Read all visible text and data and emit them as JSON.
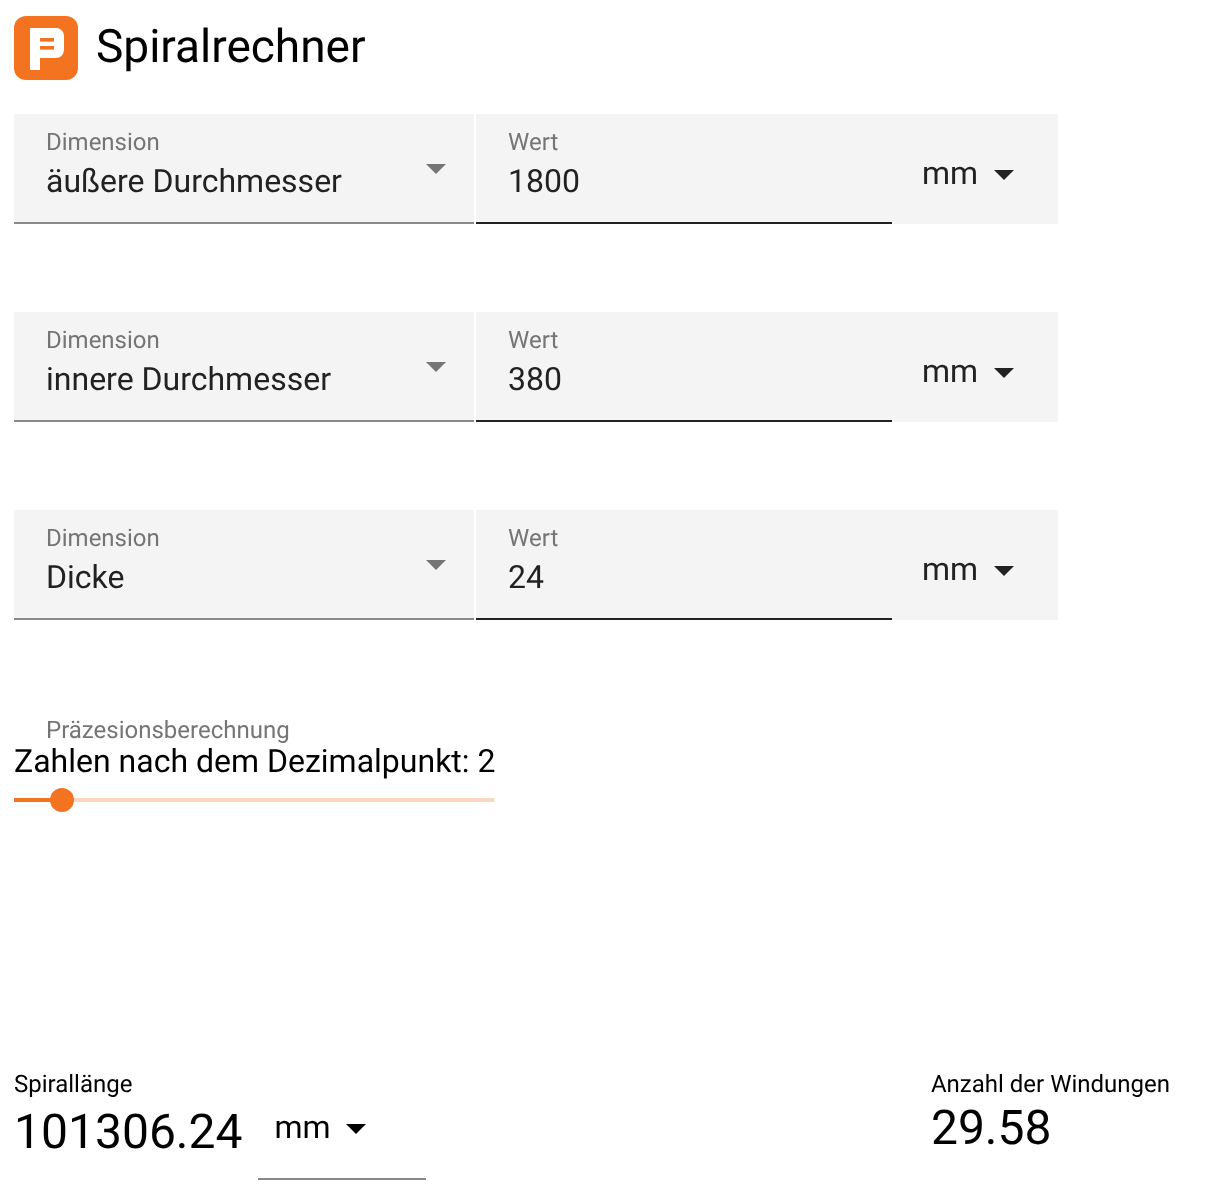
{
  "app": {
    "title": "Spiralrechner"
  },
  "rows": [
    {
      "dimension_label": "Dimension",
      "dimension": "äußere Durchmesser",
      "value_label": "Wert",
      "value": "1800",
      "unit": "mm"
    },
    {
      "dimension_label": "Dimension",
      "dimension": "innere Durchmesser",
      "value_label": "Wert",
      "value": "380",
      "unit": "mm"
    },
    {
      "dimension_label": "Dimension",
      "dimension": "Dicke",
      "value_label": "Wert",
      "value": "24",
      "unit": "mm"
    }
  ],
  "precision": {
    "label": "Präzesionsberechnung",
    "text": "Zahlen nach dem Dezimalpunkt: 2",
    "level": 0.1
  },
  "results": {
    "length_label": "Spirallänge",
    "length": "101306.24",
    "length_unit": "mm",
    "turns_label": "Anzahl der Windungen",
    "turns": "29.58"
  }
}
